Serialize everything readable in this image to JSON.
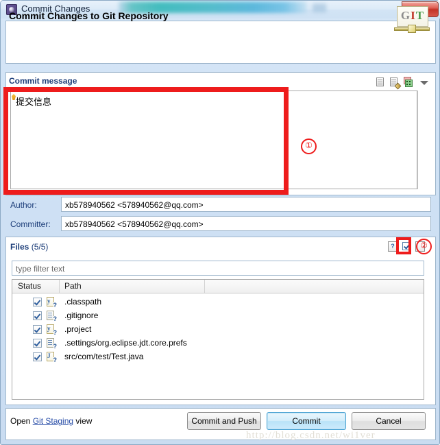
{
  "window": {
    "title": "Commit Changes",
    "app_icon": "eclipse-gear-icon",
    "close_label": "x"
  },
  "header": {
    "title": "Commit Changes to Git Repository",
    "logo": {
      "g": "G",
      "i": "I",
      "t": "T"
    }
  },
  "commit_message": {
    "group_label": "Commit message",
    "value": "提交信息",
    "toolbar": [
      {
        "name": "insert-signed-off-by-icon"
      },
      {
        "name": "insert-change-id-icon"
      },
      {
        "name": "amend-previous-commit-icon"
      },
      {
        "name": "view-menu-chevron-icon"
      }
    ]
  },
  "author": {
    "label": "Author:",
    "value": "xb578940562 <578940562@qq.com>"
  },
  "committer": {
    "label": "Committer:",
    "value": "xb578940562 <578940562@qq.com>"
  },
  "files": {
    "group_label_bold": "Files",
    "group_label_count": "(5/5)",
    "toolbar": [
      {
        "name": "show-untracked-help-icon",
        "glyph": "?"
      },
      {
        "name": "select-all-checkbox-icon"
      },
      {
        "name": "deselect-all-icon"
      }
    ],
    "filter_placeholder": "type filter text",
    "columns": [
      "Status",
      "Path"
    ],
    "rows": [
      {
        "checked": true,
        "icon": "java-properties-file-icon",
        "status": "untracked",
        "path": ".classpath"
      },
      {
        "checked": true,
        "icon": "text-file-icon",
        "status": "untracked",
        "path": ".gitignore"
      },
      {
        "checked": true,
        "icon": "java-properties-file-icon",
        "status": "untracked",
        "path": ".project"
      },
      {
        "checked": true,
        "icon": "text-file-icon",
        "status": "untracked",
        "path": ".settings/org.eclipse.jdt.core.prefs"
      },
      {
        "checked": true,
        "icon": "java-source-file-icon",
        "status": "untracked",
        "path": "src/com/test/Test.java"
      }
    ]
  },
  "footer": {
    "open_prefix": "Open",
    "link_label": "Git Staging",
    "open_suffix": "view",
    "buttons": {
      "commit_and_push": "Commit and Push",
      "commit": "Commit",
      "cancel": "Cancel"
    }
  },
  "annotations": {
    "marker_1": "①",
    "marker_2": "②"
  },
  "watermark": "http://blog.csdn.net/wi1ver",
  "colors": {
    "accent_blue": "#1b3c78",
    "annotation_red": "#ee1c1c",
    "link_blue": "#2b4fa8",
    "default_button_border": "#4ba3d3"
  }
}
